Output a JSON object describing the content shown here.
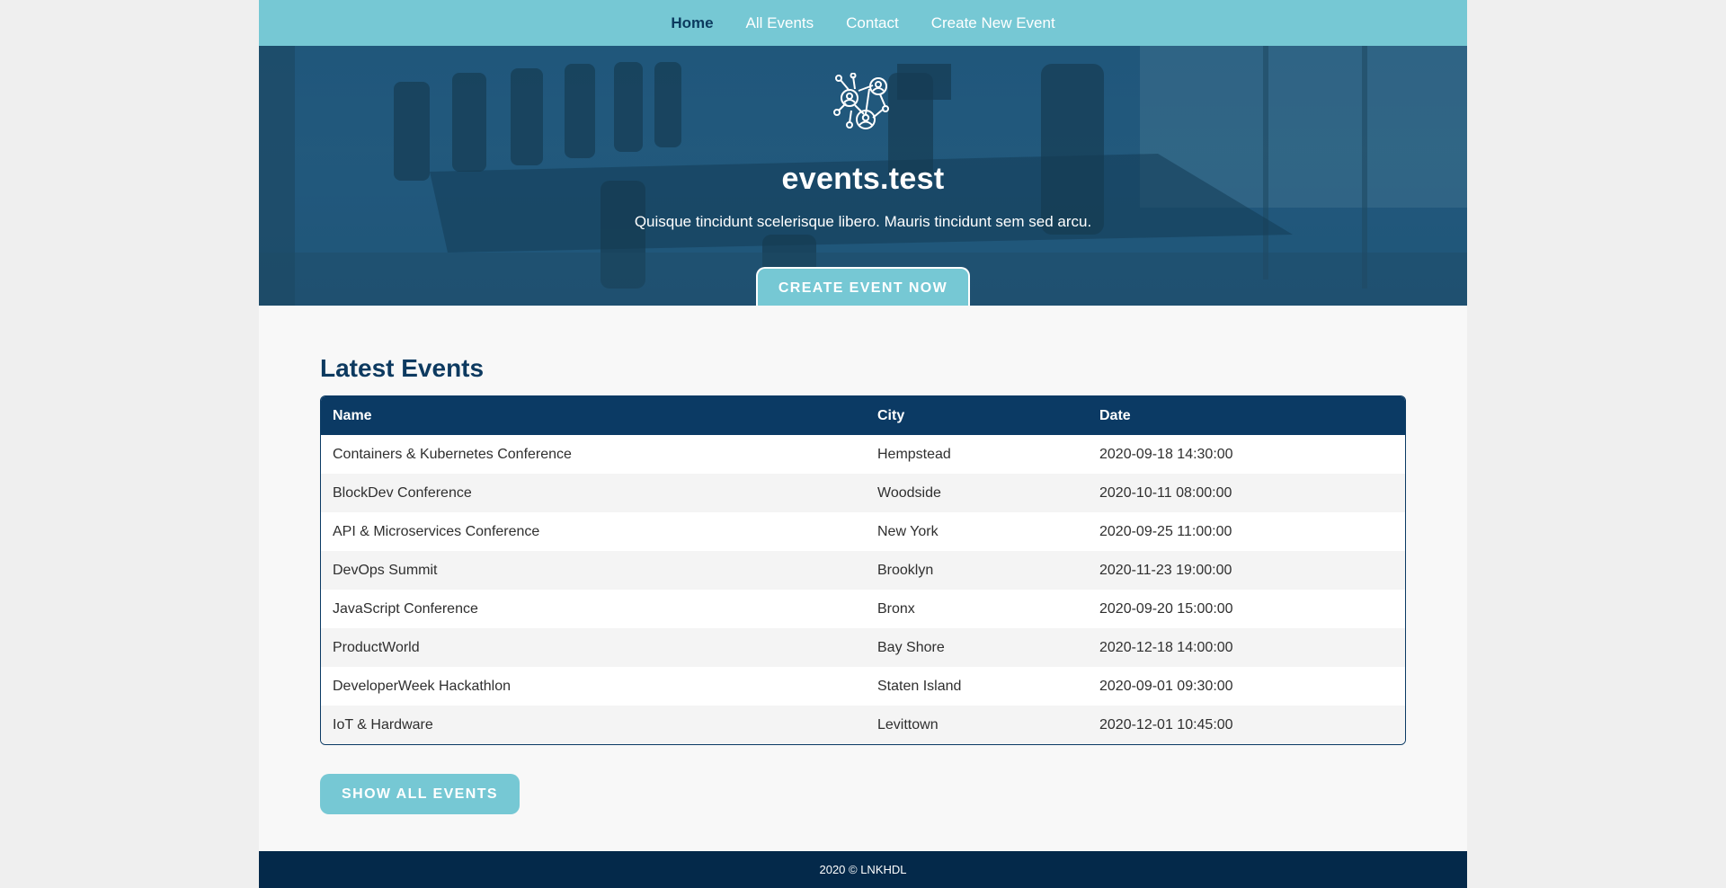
{
  "nav": {
    "items": [
      {
        "label": "Home",
        "active": true
      },
      {
        "label": "All Events",
        "active": false
      },
      {
        "label": "Contact",
        "active": false
      },
      {
        "label": "Create New Event",
        "active": false
      }
    ]
  },
  "hero": {
    "logo_icon": "network-people-icon",
    "title": "events.test",
    "subtitle": "Quisque tincidunt scelerisque libero. Mauris tincidunt sem sed arcu.",
    "cta_label": "CREATE EVENT NOW"
  },
  "events": {
    "title": "Latest Events",
    "columns": [
      "Name",
      "City",
      "Date"
    ],
    "rows": [
      [
        "Containers & Kubernetes Conference",
        "Hempstead",
        "2020-09-18 14:30:00"
      ],
      [
        "BlockDev Conference",
        "Woodside",
        "2020-10-11 08:00:00"
      ],
      [
        "API & Microservices Conference",
        "New York",
        "2020-09-25 11:00:00"
      ],
      [
        "DevOps Summit",
        "Brooklyn",
        "2020-11-23 19:00:00"
      ],
      [
        "JavaScript Conference",
        "Bronx",
        "2020-09-20 15:00:00"
      ],
      [
        "ProductWorld",
        "Bay Shore",
        "2020-12-18 14:00:00"
      ],
      [
        "DeveloperWeek Hackathlon",
        "Staten Island",
        "2020-09-01 09:30:00"
      ],
      [
        "IoT & Hardware",
        "Levittown",
        "2020-12-01 10:45:00"
      ]
    ],
    "show_all_label": "SHOW ALL EVENTS"
  },
  "footer": {
    "text": "2020 © LNKHDL"
  },
  "colors": {
    "nav_bg": "#76c8d4",
    "accent": "#76c8d4",
    "dark_blue": "#0b3a64",
    "footer_bg": "#04294a"
  }
}
